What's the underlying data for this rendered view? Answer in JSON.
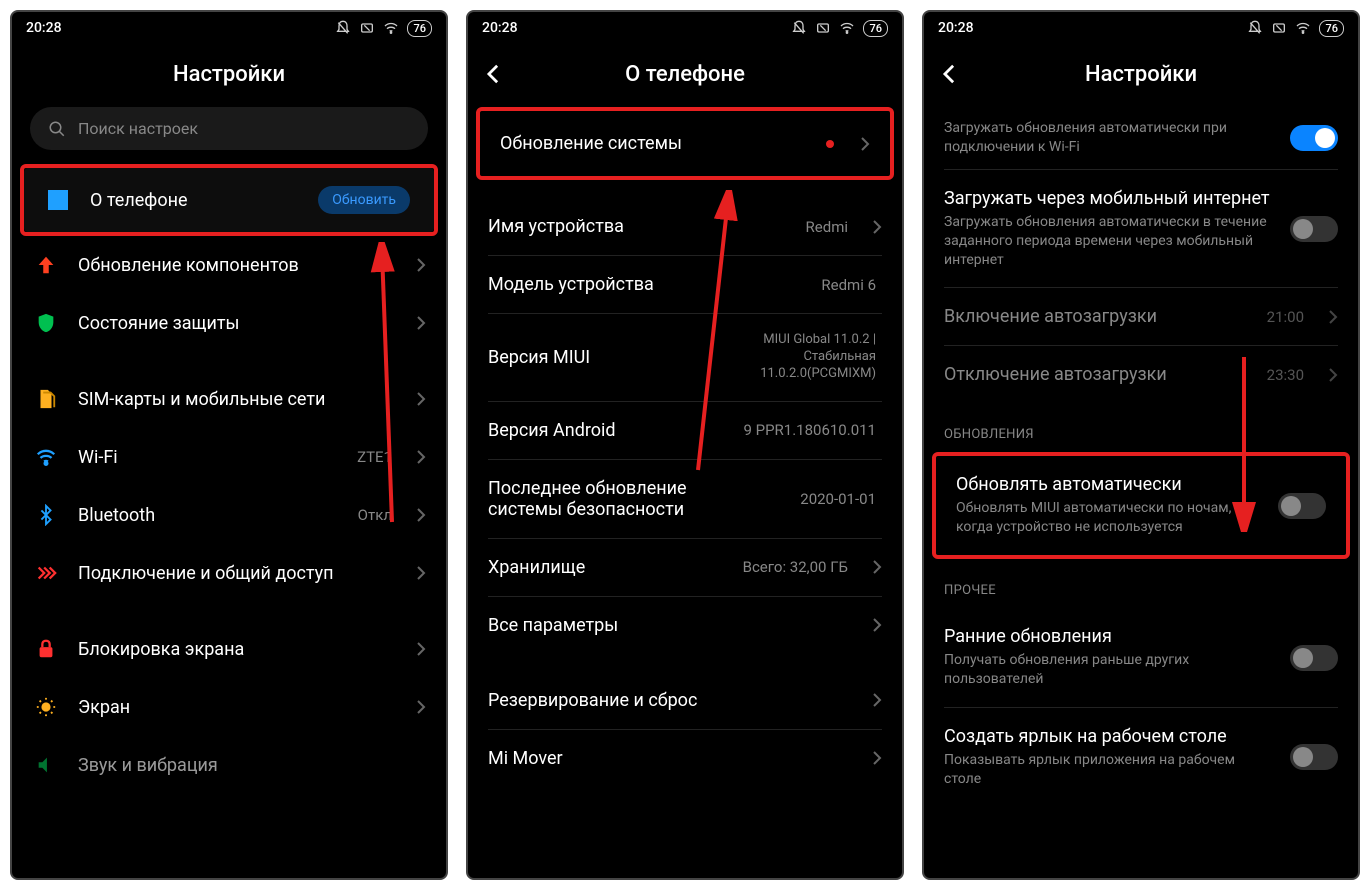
{
  "status": {
    "time": "20:28",
    "battery": "76"
  },
  "screen1": {
    "title": "Настройки",
    "search_placeholder": "Поиск настроек",
    "about_phone": "О телефоне",
    "update_btn": "Обновить",
    "items": {
      "component_updates": "Обновление компонентов",
      "security_status": "Состояние защиты",
      "sim": "SIM-карты и мобильные сети",
      "wifi": "Wi-Fi",
      "wifi_val": "ZTE1",
      "bluetooth": "Bluetooth",
      "bluetooth_val": "Откл",
      "share": "Подключение и общий доступ",
      "lock": "Блокировка экрана",
      "display": "Экран",
      "sound": "Звук и вибрация"
    }
  },
  "screen2": {
    "title": "О телефоне",
    "system_update": "Обновление системы",
    "device_name": "Имя устройства",
    "device_name_val": "Redmi",
    "model": "Модель устройства",
    "model_val": "Redmi 6",
    "miui": "Версия MIUI",
    "miui_val": "MIUI Global 11.0.2 | Стабильная 11.0.2.0(PCGMIXM)",
    "android": "Версия Android",
    "android_val": "9 PPR1.180610.011",
    "security_patch": "Последнее обновление системы безопасности",
    "security_patch_val": "2020-01-01",
    "storage": "Хранилище",
    "storage_val": "Всего: 32,00 ГБ",
    "all_params": "Все параметры",
    "backup": "Резервирование и сброс",
    "mi_mover": "Mi Mover"
  },
  "screen3": {
    "title": "Настройки",
    "wifi_dl": "Загружать обновления автоматически при подключении к Wi-Fi",
    "mobile_dl_title": "Загружать через мобильный интернет",
    "mobile_dl_sub": "Загружать обновления автоматически в течение заданного периода времени через мобильный интернет",
    "autoload_on": "Включение автозагрузки",
    "autoload_on_val": "21:00",
    "autoload_off": "Отключение автозагрузки",
    "autoload_off_val": "23:30",
    "section_updates": "ОБНОВЛЕНИЯ",
    "auto_update_title": "Обновлять автоматически",
    "auto_update_sub": "Обновлять MIUI автоматически по ночам, когда устройство не используется",
    "section_other": "ПРОЧЕЕ",
    "early_title": "Ранние обновления",
    "early_sub": "Получать обновления раньше других пользователей",
    "shortcut_title": "Создать ярлык на рабочем столе",
    "shortcut_sub": "Показывать ярлык приложения на рабочем столе"
  }
}
